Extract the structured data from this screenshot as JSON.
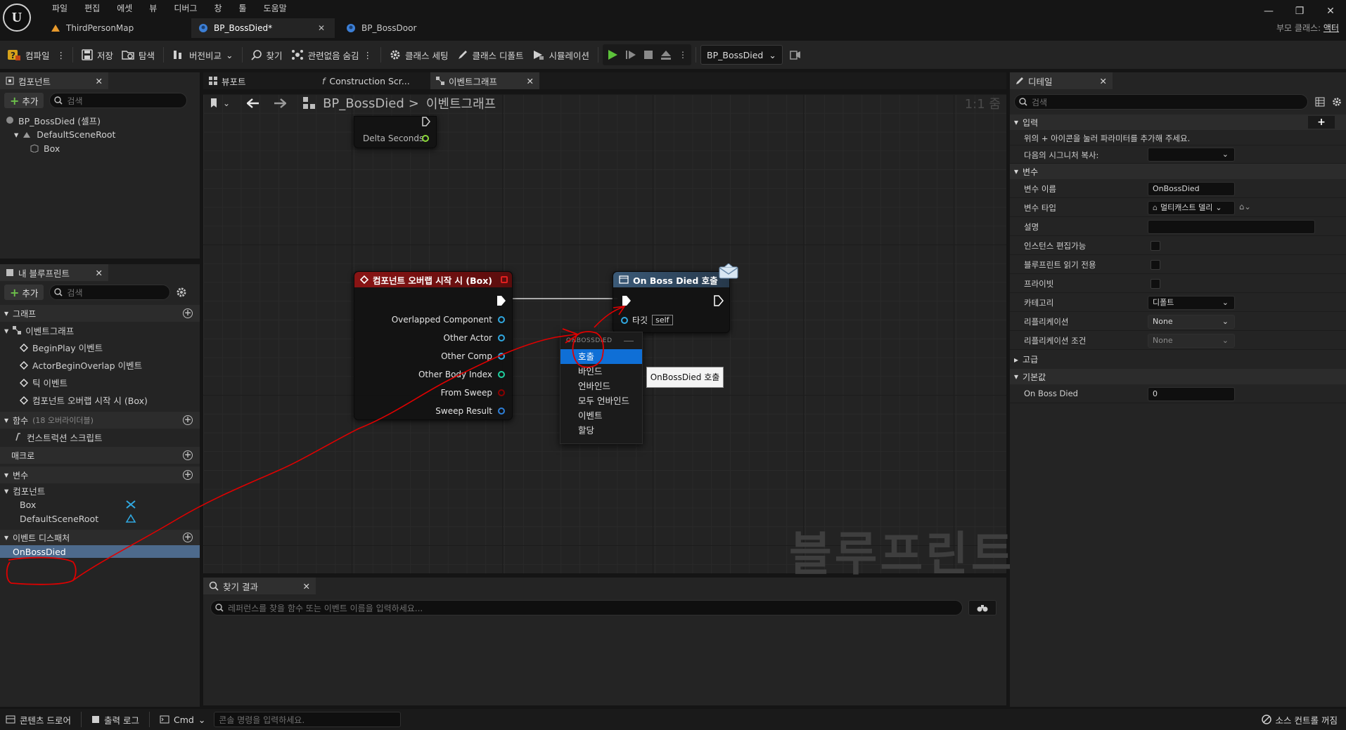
{
  "app": {
    "menu": [
      "파일",
      "편집",
      "에셋",
      "뷰",
      "디버그",
      "창",
      "툴",
      "도움말"
    ],
    "parent_class_label": "부모 클래스:",
    "parent_class_value": "액터",
    "window_controls": [
      "—",
      "❐",
      "✕"
    ]
  },
  "doc_tabs": [
    {
      "label": "ThirdPersonMap",
      "icon": "level-icon",
      "active": false
    },
    {
      "label": "BP_BossDied*",
      "icon": "blueprint-icon",
      "active": true
    },
    {
      "label": "BP_BossDoor",
      "icon": "blueprint-icon",
      "active": false
    }
  ],
  "toolbar": {
    "compile": "컴파일",
    "save": "저장",
    "browse": "탐색",
    "diff": "버전비교",
    "find": "찾기",
    "hide_unrelated": "관련없음 숨김",
    "class_settings": "클래스 세팅",
    "class_defaults": "클래스 디폴트",
    "simulation": "시뮬레이션",
    "debug_object": "BP_BossDied"
  },
  "components_panel": {
    "tab": "컴포넌트",
    "add": "추가",
    "search_placeholder": "검색",
    "items": [
      "BP_BossDied (셀프)",
      "DefaultSceneRoot",
      "Box"
    ]
  },
  "my_blueprint": {
    "tab": "내 블루프린트",
    "add": "추가",
    "search_placeholder": "검색",
    "graphs_header": "그래프",
    "event_graph": "이벤트그래프",
    "events": [
      "BeginPlay 이벤트",
      "ActorBeginOverlap 이벤트",
      "틱 이벤트",
      "컴포넌트 오버랩 시작 시 (Box)"
    ],
    "functions_header": "함수",
    "functions_count": "(18 오버라이더블)",
    "construction_script": "컨스트럭션 스크립트",
    "macros_header": "매크로",
    "variables_header": "변수",
    "components_header": "컴포넌트",
    "variable_items": [
      "Box",
      "DefaultSceneRoot"
    ],
    "dispatchers_header": "이벤트 디스패처",
    "dispatcher_items": [
      "OnBossDied"
    ]
  },
  "graph_tabs": [
    {
      "label": "뷰포트",
      "active": false
    },
    {
      "label": "Construction Scr...",
      "active": false
    },
    {
      "label": "이벤트그래프",
      "active": true
    }
  ],
  "graph": {
    "breadcrumb_root": "BP_BossDied",
    "breadcrumb_sep": ">",
    "breadcrumb_current": "이벤트그래프",
    "zoom": "1:1 줌",
    "watermark": "블루프린트",
    "tick_node_pin": "Delta Seconds",
    "overlap_node": {
      "title": "컴포넌트 오버랩 시작 시 (Box)",
      "pins": [
        "Overlapped Component",
        "Other Actor",
        "Other Comp",
        "Other Body Index",
        "From Sweep",
        "Sweep Result"
      ]
    },
    "call_node": {
      "title": "On Boss Died 호출",
      "target_label": "타깃",
      "target_value": "self"
    },
    "context_menu": {
      "header": "ONBOSSDIED",
      "items": [
        "호출",
        "바인드",
        "언바인드",
        "모두 언바인드",
        "이벤트",
        "할당"
      ],
      "selected_index": 0
    },
    "tooltip": "OnBossDied 호출"
  },
  "find_results": {
    "tab": "찾기 결과",
    "placeholder": "레퍼런스를 찾을 함수 또는 이벤트 이름을 입력하세요..."
  },
  "details": {
    "tab": "디테일",
    "search_placeholder": "검색",
    "inputs_header": "입력",
    "inputs_hint": "위의 + 아이콘을 눌러 파라미터를 추가해 주세요.",
    "copy_signature_label": "다음의 시그니처 복사:",
    "variable_header": "변수",
    "var_name_label": "변수 이름",
    "var_name_value": "OnBossDied",
    "var_type_label": "변수 타입",
    "var_type_value": "멀티캐스트 델리",
    "description_label": "설명",
    "instance_editable_label": "인스턴스 편집가능",
    "bp_readonly_label": "블루프린트 읽기 전용",
    "private_label": "프라이빗",
    "category_label": "카테고리",
    "category_value": "디폴트",
    "replication_label": "리플리케이션",
    "replication_value": "None",
    "replication_cond_label": "리플리케이션 조건",
    "replication_cond_value": "None",
    "advanced_header": "고급",
    "defaults_header": "기본값",
    "default_name": "On Boss Died",
    "default_value": "0"
  },
  "statusbar": {
    "content_drawer": "콘텐츠 드로어",
    "output_log": "출력 로그",
    "cmd": "Cmd",
    "console_placeholder": "콘솔 명령을 입력하세요.",
    "source_control": "소스 컨트롤 꺼짐"
  },
  "colors": {
    "event_node_header": "#8a1414",
    "call_node_header": "#3b5a78",
    "selection": "#0f6fd6",
    "annotation": "#e00000",
    "exec_pin": "#ffffff",
    "object_pin": "#30a8e0",
    "bool_pin": "#8b0000",
    "int_pin": "#1fd1a0"
  }
}
